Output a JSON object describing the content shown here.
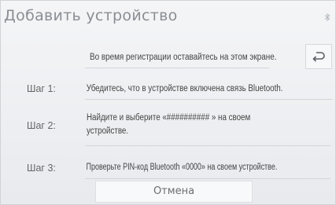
{
  "window": {
    "title": "Добавить устройство"
  },
  "icons": {
    "status": "bluetooth-icon",
    "back": "back-arrow-icon"
  },
  "hint": "Во время регистрации оставайтесь на этом экране.",
  "steps": [
    {
      "label": "Шаг 1:",
      "text_lines": [
        "Убедитесь, что в устройстве включена связь Bluetooth."
      ]
    },
    {
      "label": "Шаг 2:",
      "text_lines": [
        "Найдите и выберите «########## » на своем",
        "устройстве."
      ]
    },
    {
      "label": "Шаг 3:",
      "text_lines": [
        "Проверьте PIN-код Bluetooth «0000» на своем устройстве."
      ]
    }
  ],
  "buttons": {
    "cancel": "Отмена"
  },
  "colors": {
    "background": "#eeeff2",
    "title_text": "#8a8d92",
    "body_text": "#444444"
  }
}
